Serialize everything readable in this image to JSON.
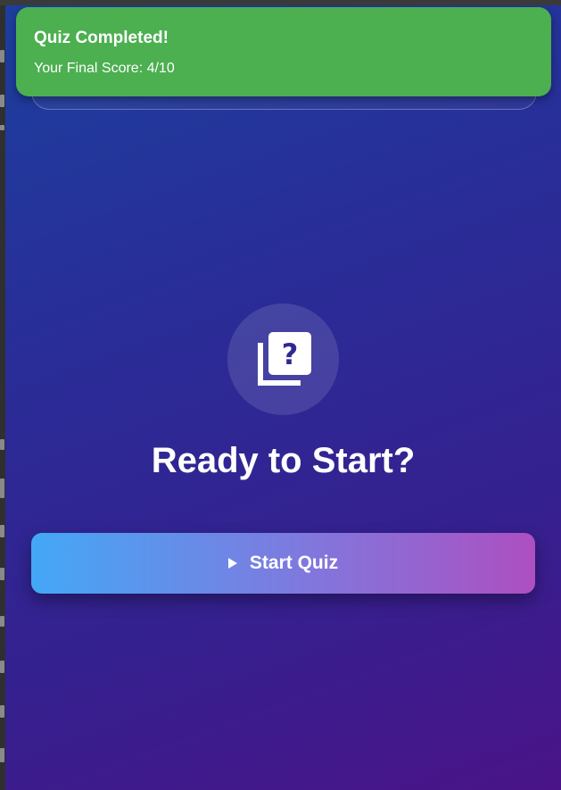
{
  "snackbar": {
    "title": "Quiz Completed!",
    "message": "Your Final Score: 4/10",
    "color": "#4caf50"
  },
  "main": {
    "icon": "quiz-icon",
    "heading": "Ready to Start?",
    "start_button": {
      "label": "Start Quiz",
      "icon": "play-icon"
    }
  },
  "colors": {
    "background_start": "#1c3f9e",
    "background_end": "#4a1488",
    "button_gradient_start": "#43a8f6",
    "button_gradient_end": "#ad4fc1"
  }
}
